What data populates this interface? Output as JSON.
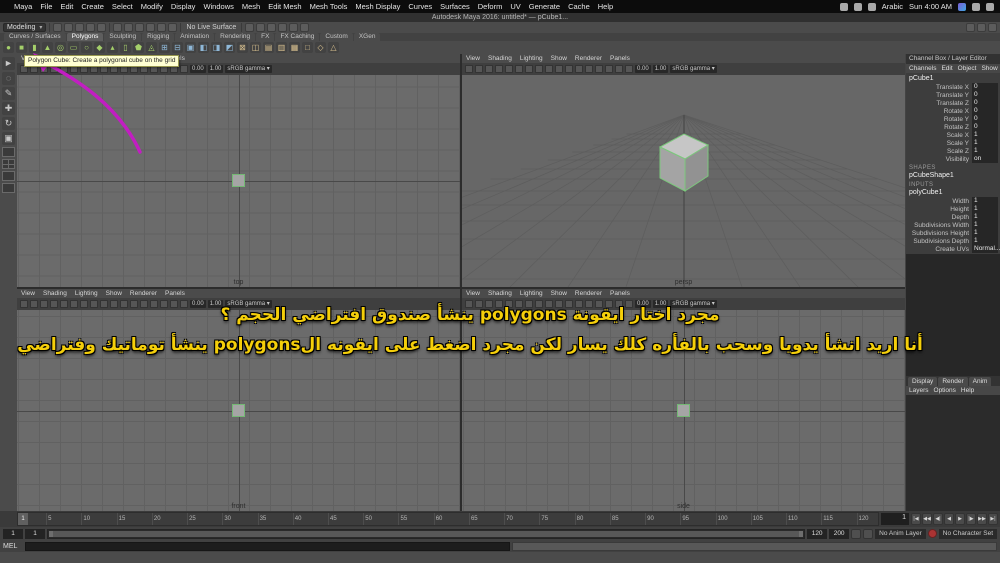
{
  "icons": {
    "chevron": "▾",
    "apple": ""
  },
  "mac_menubar": {
    "menus": [
      "Maya",
      "File",
      "Edit",
      "Create",
      "Select",
      "Modify",
      "Display",
      "Windows",
      "Mesh",
      "Edit Mesh",
      "Mesh Tools",
      "Mesh Display",
      "Curves",
      "Surfaces",
      "Deform",
      "UV",
      "Generate",
      "Cache",
      "Help"
    ],
    "right_icons": [
      "keyboard-icon",
      "bluetooth-icon",
      "battery-icon"
    ],
    "input_source": "Arabic",
    "clock": "Sun 4:00 AM",
    "far_right_icons": [
      "siri-icon",
      "spotlight-icon",
      "notification-center-icon"
    ]
  },
  "window_title": "Autodesk Maya 2016: untitled* — pCube1...",
  "status_line": {
    "menuset": "Modeling",
    "left_icons": [
      "new-scene-icon",
      "open-scene-icon",
      "save-scene-icon",
      "undo-icon",
      "redo-icon"
    ],
    "snap_icons": [
      "snap-to-grid-icon",
      "snap-to-curve-icon",
      "snap-to-point-icon",
      "snap-to-projected-center-icon",
      "snap-to-view-plane-icon",
      "make-live-icon"
    ],
    "live_surface": "No Live Surface",
    "history_icons": [
      "construction-history-icon",
      "render-current-frame-icon",
      "ipr-render-icon",
      "render-settings-icon",
      "paint-effects-icon",
      "hypershade-icon"
    ],
    "right_icons": [
      "attribute-editor-toggle-icon",
      "tool-settings-toggle-icon",
      "channel-box-toggle-icon"
    ]
  },
  "shelf": {
    "tabs": [
      "Curves / Surfaces",
      "Polygons",
      "Sculpting",
      "Rigging",
      "Animation",
      "Rendering",
      "FX",
      "FX Caching",
      "Custom",
      "XGen"
    ],
    "active_tab": "Polygons",
    "icons": [
      {
        "name": "polygon-sphere",
        "glyph": "●",
        "color": "#a4cf6a"
      },
      {
        "name": "polygon-cube",
        "glyph": "■",
        "color": "#a4cf6a"
      },
      {
        "name": "polygon-cylinder",
        "glyph": "▮",
        "color": "#a4cf6a"
      },
      {
        "name": "polygon-cone",
        "glyph": "▲",
        "color": "#a4cf6a"
      },
      {
        "name": "polygon-torus",
        "glyph": "◎",
        "color": "#a4cf6a"
      },
      {
        "name": "polygon-plane",
        "glyph": "▭",
        "color": "#a4cf6a"
      },
      {
        "name": "polygon-disc",
        "glyph": "○",
        "color": "#a4cf6a"
      },
      {
        "name": "polygon-platonic",
        "glyph": "◆",
        "color": "#a4cf6a"
      },
      {
        "name": "polygon-pyramid",
        "glyph": "▴",
        "color": "#a4cf6a"
      },
      {
        "name": "polygon-pipe",
        "glyph": "▯",
        "color": "#a4cf6a"
      },
      {
        "name": "polygon-prism",
        "glyph": "⬟",
        "color": "#a4cf6a"
      },
      {
        "name": "polygon-helix",
        "glyph": "◬",
        "color": "#a4cf6a"
      },
      {
        "name": "combine",
        "glyph": "⊞",
        "color": "#8fb8d8"
      },
      {
        "name": "separate",
        "glyph": "⊟",
        "color": "#8fb8d8"
      },
      {
        "name": "smooth",
        "glyph": "▣",
        "color": "#8fb8d8"
      },
      {
        "name": "boolean-union",
        "glyph": "◧",
        "color": "#8fb8d8"
      },
      {
        "name": "boolean-difference",
        "glyph": "◨",
        "color": "#8fb8d8"
      },
      {
        "name": "boolean-intersection",
        "glyph": "◩",
        "color": "#8fb8d8"
      },
      {
        "name": "extrude",
        "glyph": "⊠",
        "color": "#d8c08f"
      },
      {
        "name": "bevel",
        "glyph": "◫",
        "color": "#d8c08f"
      },
      {
        "name": "bridge",
        "glyph": "▤",
        "color": "#d8c08f"
      },
      {
        "name": "multi-cut",
        "glyph": "▥",
        "color": "#d8c08f"
      },
      {
        "name": "insert-edge-loop",
        "glyph": "▦",
        "color": "#d8c08f"
      },
      {
        "name": "quad-draw",
        "glyph": "□",
        "color": "#d8c08f"
      },
      {
        "name": "mirror",
        "glyph": "◇",
        "color": "#d8c08f"
      },
      {
        "name": "sculpt",
        "glyph": "△",
        "color": "#d8c08f"
      }
    ]
  },
  "tooltip": "Polygon Cube: Create a polygonal cube on the grid",
  "toolbox": {
    "tools": [
      {
        "name": "select-tool",
        "glyph": "►"
      },
      {
        "name": "lasso-select-tool",
        "glyph": "◌"
      },
      {
        "name": "paint-select-tool",
        "glyph": "✎"
      },
      {
        "name": "move-tool",
        "glyph": "✚"
      },
      {
        "name": "rotate-tool",
        "glyph": "↻"
      },
      {
        "name": "scale-tool",
        "glyph": "▣"
      }
    ],
    "layouts": [
      "single-pane-layout-button",
      "four-pane-layout-button",
      "persp-outliner-layout-button",
      "persp-graph-layout-button"
    ]
  },
  "viewport": {
    "menu_items": [
      "View",
      "Shading",
      "Lighting",
      "Show",
      "Renderer",
      "Panels"
    ],
    "toolbar_icons": [
      "select-camera-icon",
      "lock-camera-icon",
      "camera-attributes-icon",
      "bookmarks-icon",
      "image-plane-icon",
      "2d-pan-zoom-icon",
      "oversampling-icon",
      "default-material-icon",
      "wireframe-mode-icon",
      "shaded-mode-icon",
      "textured-mode-icon",
      "use-all-lights-icon",
      "shadows-icon",
      "ambient-occlusion-icon",
      "motion-blur-icon",
      "multisampling-icon",
      "gate-mask-icon"
    ],
    "exposure": "0.00",
    "gamma": "1.00",
    "colorspace": "sRGB gamma",
    "views": [
      {
        "label": "top"
      },
      {
        "label": "persp"
      },
      {
        "label": "front"
      },
      {
        "label": "side"
      }
    ]
  },
  "channel_box": {
    "title": "Channel Box / Layer Editor",
    "menus": [
      "Channels",
      "Edit",
      "Object",
      "Show"
    ],
    "node": "pCube1",
    "transform_attrs": [
      [
        "Translate X",
        "0"
      ],
      [
        "Translate Y",
        "0"
      ],
      [
        "Translate Z",
        "0"
      ],
      [
        "Rotate X",
        "0"
      ],
      [
        "Rotate Y",
        "0"
      ],
      [
        "Rotate Z",
        "0"
      ],
      [
        "Scale X",
        "1"
      ],
      [
        "Scale Y",
        "1"
      ],
      [
        "Scale Z",
        "1"
      ],
      [
        "Visibility",
        "on"
      ]
    ],
    "shapes_header": "SHAPES",
    "shape_node": "pCubeShape1",
    "inputs_header": "INPUTS",
    "input_node": "polyCube1",
    "input_attrs": [
      [
        "Width",
        "1"
      ],
      [
        "Height",
        "1"
      ],
      [
        "Depth",
        "1"
      ],
      [
        "Subdivisions Width",
        "1"
      ],
      [
        "Subdivisions Height",
        "1"
      ],
      [
        "Subdivisions Depth",
        "1"
      ],
      [
        "Create UVs",
        "Normal..."
      ]
    ],
    "layer_tabs": [
      "Display",
      "Render",
      "Anim"
    ],
    "layer_menus": [
      "Layers",
      "Options",
      "Help"
    ]
  },
  "overlay": {
    "line1": "مجرد اختار ايقونة polygons ينشأ صندوق افتراضي الحجم ؟",
    "line2": "أنا اريد انشأ يدويا وسحب بالفأره كلك يسار لكن مجرد اضغط على ايقونه الpolygons ينشأ توماتيك وفتراضي"
  },
  "annotation": {
    "arrow_color": "#c21ec2"
  },
  "timeline": {
    "start": 1,
    "end": 120,
    "step": 5,
    "current": "1"
  },
  "playback": [
    {
      "name": "go-to-start-button",
      "glyph": "|◀"
    },
    {
      "name": "step-back-frame-button",
      "glyph": "◀◀"
    },
    {
      "name": "step-back-key-button",
      "glyph": "◀|"
    },
    {
      "name": "play-backwards-button",
      "glyph": "◀"
    },
    {
      "name": "play-forwards-button",
      "glyph": "▶"
    },
    {
      "name": "step-forward-key-button",
      "glyph": "|▶"
    },
    {
      "name": "step-forward-frame-button",
      "glyph": "▶▶"
    },
    {
      "name": "go-to-end-button",
      "glyph": "▶|"
    }
  ],
  "range": {
    "animation_start": "1",
    "playback_start": "1",
    "playback_end": "120",
    "animation_end": "200",
    "icons": [
      "playback-options-icon",
      "auto-keyframe-toggle-icon"
    ],
    "anim_layer": "No Anim Layer",
    "character_set": "No Character Set"
  },
  "command_line": {
    "label": "MEL"
  }
}
